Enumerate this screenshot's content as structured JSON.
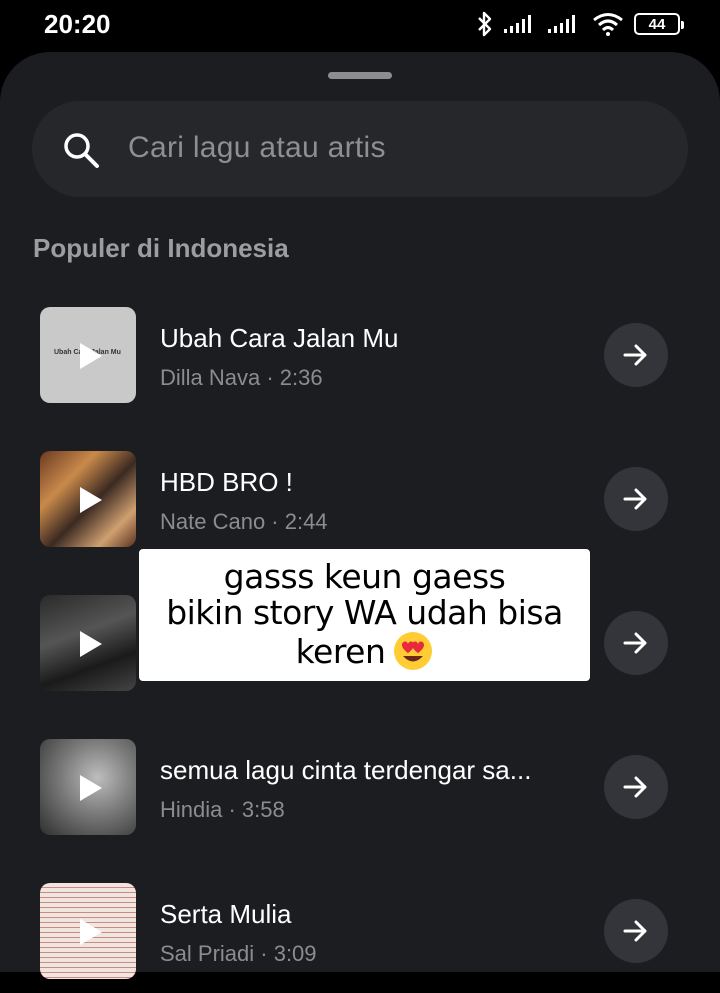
{
  "status": {
    "time": "20:20",
    "battery": "44",
    "icons": [
      "bluetooth-icon",
      "signal-icon",
      "signal-icon",
      "wifi-icon",
      "battery-icon"
    ]
  },
  "search": {
    "placeholder": "Cari lagu atau artis",
    "icon": "search-icon"
  },
  "section_title": "Populer di Indonesia",
  "tracks": [
    {
      "title": "Ubah Cara Jalan Mu",
      "subtitle": "Dilla Nava · 2:36",
      "cover_text": "Ubah Cara Jalan Mu"
    },
    {
      "title": "HBD BRO !",
      "subtitle": "Nate Cano · 2:44"
    },
    {
      "title": "",
      "subtitle": ""
    },
    {
      "title": "semua lagu cinta terdengar sa...",
      "subtitle": "Hindia · 3:58"
    },
    {
      "title": "Serta Mulia",
      "subtitle": "Sal Priadi · 3:09"
    }
  ],
  "caption": {
    "line1": "gasss keun gaess",
    "line2": "bikin story WA udah bisa",
    "line3": "keren",
    "emoji": "heart-eyes-emoji"
  },
  "colors": {
    "sheet_bg": "#1c1d20",
    "search_bg": "#25272a",
    "button_bg": "#33353a",
    "muted_text": "#8b8c90"
  }
}
